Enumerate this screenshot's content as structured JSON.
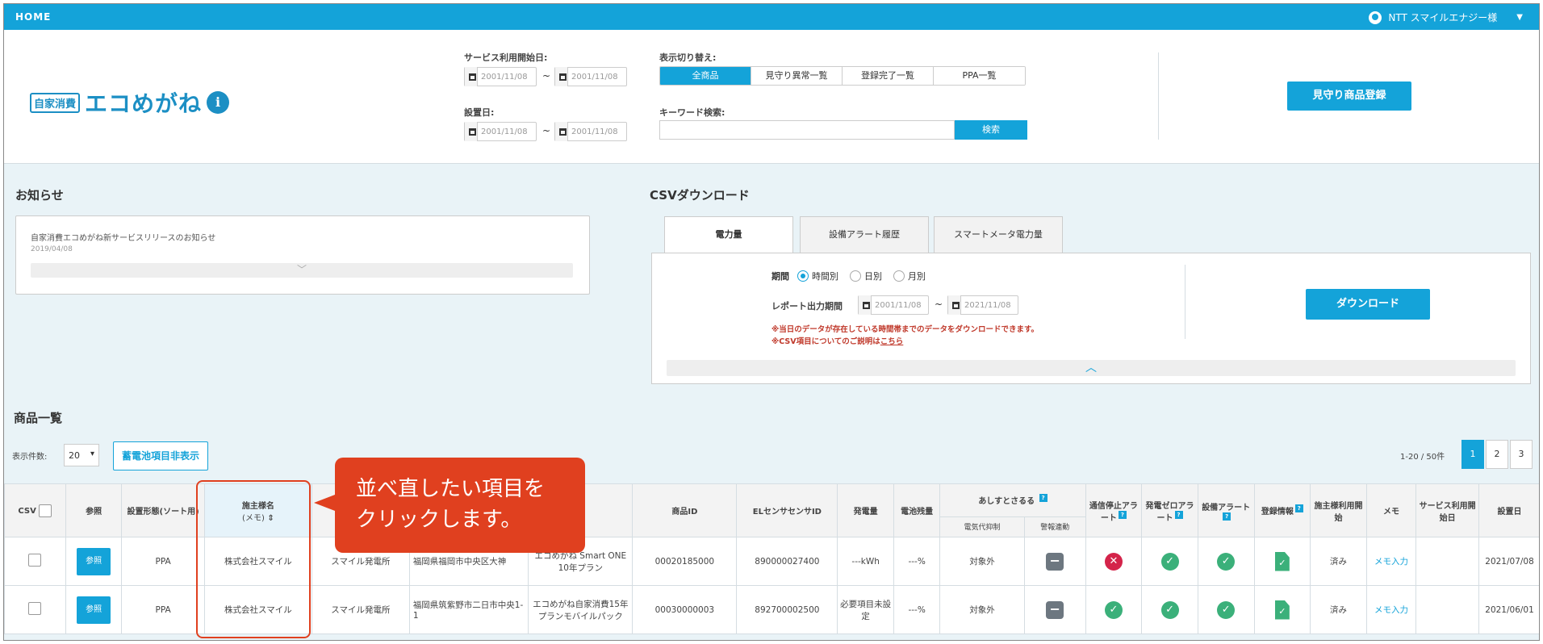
{
  "topbar": {
    "home": "HOME",
    "user": "NTT スマイルエナジー様"
  },
  "logo": {
    "tag": "自家消費",
    "name": "エコめがね",
    "info": "i"
  },
  "filters": {
    "service_start_label": "サービス利用開始日:",
    "install_label": "設置日:",
    "date_from": "2001/11/08",
    "date_to": "2001/11/08",
    "tilde": "~",
    "view_label": "表示切り替え:",
    "view_options": [
      "全商品",
      "見守り異常一覧",
      "登録完了一覧",
      "PPA一覧"
    ],
    "keyword_label": "キーワード検索:",
    "search_btn": "検索"
  },
  "register_btn": "見守り商品登録",
  "notice": {
    "title": "お知らせ",
    "item": "自家消費エコめがね新サービスリリースのお知らせ",
    "date": "2019/04/08"
  },
  "csv": {
    "title": "CSVダウンロード",
    "tabs": [
      "電力量",
      "設備アラート履歴",
      "スマートメータ電力量"
    ],
    "period_label": "期間",
    "period_options": [
      "時間別",
      "日別",
      "月別"
    ],
    "report_label": "レポート出力期間",
    "report_from": "2001/11/08",
    "report_to": "2021/11/08",
    "note1": "※当日のデータが存在している時間帯までのデータをダウンロードできます。",
    "note2": "※CSV項目についてのご説明は",
    "note2_link": "こちら",
    "download_btn": "ダウンロード"
  },
  "list": {
    "title": "商品一覧",
    "count_label": "表示件数:",
    "count_value": "20",
    "battery_toggle": "蓄電池項目非表示",
    "range": "1-20 / 50件",
    "pages": [
      "1",
      "2",
      "3"
    ]
  },
  "table": {
    "headers": {
      "csv": "CSV",
      "ref": "参照",
      "type": "設置形態(ソート用)",
      "owner": "施主様名",
      "owner_sub": "(メモ)",
      "product_id": "商品ID",
      "el": "ELセンサセンサID",
      "gen": "発電量",
      "batt": "電池残量",
      "ashita": "あしすとさるる",
      "ashita_sub1": "電気代抑制",
      "ashita_sub2": "警報連動",
      "comm": "通信停止アラート",
      "zero": "発電ゼロアラート",
      "equip": "設備アラート",
      "reg": "登録情報",
      "ownerstart": "施主様利用開始",
      "memo": "メモ",
      "service": "サービス利用開始日",
      "installed": "設置日"
    },
    "rows": [
      {
        "ref": "参照",
        "type": "PPA",
        "owner": "株式会社スマイル",
        "site": "スマイル発電所",
        "address": "福岡県福岡市中央区大神",
        "plan": "エコめがね Smart ONE 10年プラン",
        "product_id": "00020185000",
        "el": "890000027400",
        "gen": "---kWh",
        "batt": "---%",
        "suppress": "対象外",
        "comm": "x",
        "ownerstart": "済み",
        "memo": "メモ入力",
        "installed": "2021/07/08"
      },
      {
        "ref": "参照",
        "type": "PPA",
        "owner": "株式会社スマイル",
        "site": "スマイル発電所",
        "address": "福岡県筑紫野市二日市中央1-1",
        "plan": "エコめがね自家消費15年プランモバイルパック",
        "product_id": "00030000003",
        "el": "892700002500",
        "gen": "必要項目未設定",
        "batt": "---%",
        "suppress": "対象外",
        "comm": "ok",
        "ownerstart": "済み",
        "memo": "メモ入力",
        "installed": "2021/06/01"
      }
    ]
  },
  "callout": {
    "line1": "並べ直したい項目を",
    "line2": "クリックします。"
  }
}
